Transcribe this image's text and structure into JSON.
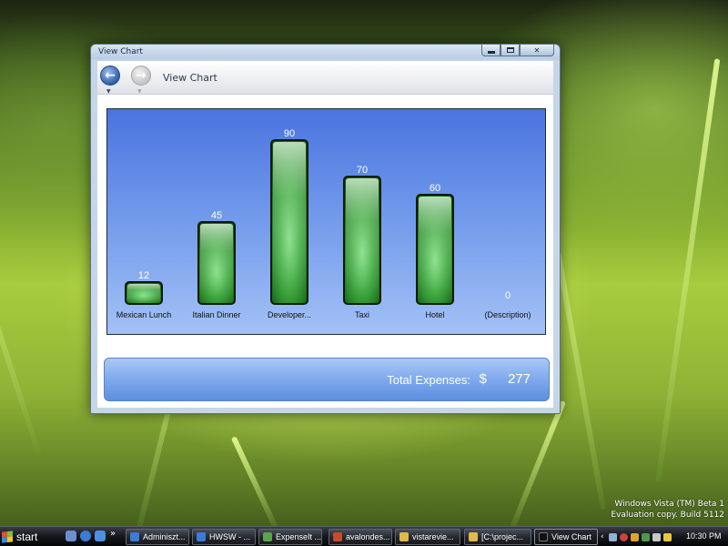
{
  "window": {
    "title": "View Chart",
    "controls": {
      "minimize": "minimize",
      "maximize": "maximize",
      "close": "close"
    }
  },
  "navbar": {
    "page_title": "View Chart",
    "back_icon": "back-arrow-icon",
    "forward_icon": "forward-arrow-icon"
  },
  "chart_data": {
    "type": "bar",
    "categories": [
      "Mexican Lunch",
      "Italian Dinner",
      "Developer...",
      "Taxi",
      "Hotel",
      "(Description)"
    ],
    "values": [
      12,
      45,
      90,
      70,
      60,
      0
    ],
    "ylim": [
      0,
      90
    ],
    "grid": false,
    "legend": "none",
    "colors": {
      "bar_top": "#b9e0b9",
      "bar_mid": "#4bb04b",
      "bar_bottom": "#0b5a0b",
      "background_top": "#4a74e0",
      "background_bottom": "#a3c1f6"
    }
  },
  "totals": {
    "label": "Total Expenses:",
    "currency": "$",
    "value": "277"
  },
  "desktop": {
    "watermark_line1": "Windows Vista (TM) Beta 1",
    "watermark_line2": "Evaluation copy. Build 5112"
  },
  "taskbar": {
    "start_label": "start",
    "quick_launch_more": "»",
    "buttons": [
      {
        "label": "Adminiszt...",
        "icon": "ie-icon"
      },
      {
        "label": "HWSW - ...",
        "icon": "ie-icon"
      },
      {
        "label": "ExpenseIt ...",
        "icon": "app-icon"
      },
      {
        "label": "avalondes...",
        "icon": "document-icon"
      },
      {
        "label": "vistarevie...",
        "icon": "folder-icon"
      },
      {
        "label": "[C:\\projec...",
        "icon": "folder-icon"
      },
      {
        "label": "View Chart",
        "icon": "window-icon"
      }
    ],
    "tray_arrow": "‹",
    "clock": "10:30 PM"
  }
}
